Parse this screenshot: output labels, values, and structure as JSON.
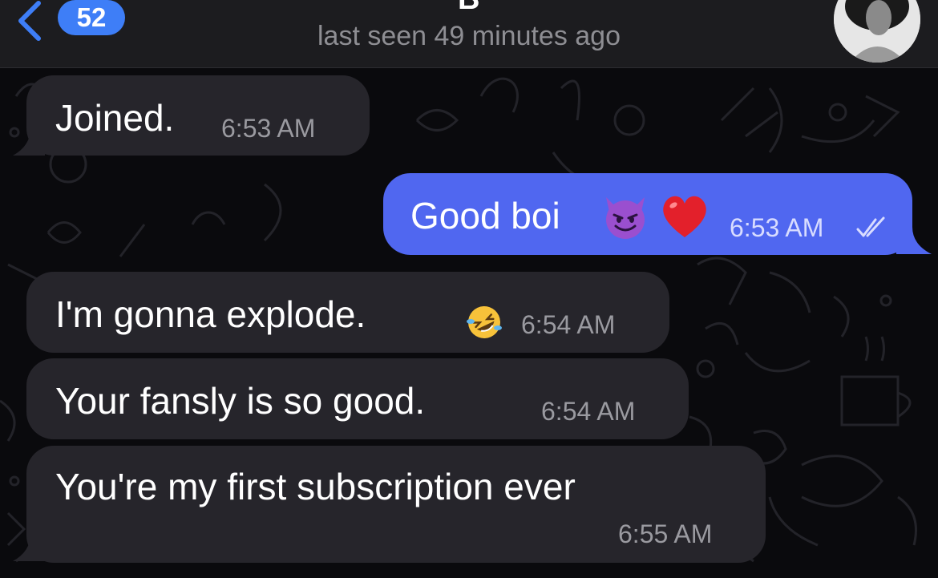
{
  "header": {
    "back_count": "52",
    "title_fragment": "B",
    "status": "last seen 49 minutes ago"
  },
  "messages": [
    {
      "direction": "incoming",
      "text": "Joined.",
      "time": "6:53 AM"
    },
    {
      "direction": "outgoing",
      "text": "Good boi",
      "emojis": [
        "smiling-devil",
        "red-heart"
      ],
      "time": "6:53 AM",
      "read": true
    },
    {
      "direction": "incoming",
      "text": "I'm gonna explode.",
      "emojis": [
        "rofl"
      ],
      "time": "6:54 AM"
    },
    {
      "direction": "incoming",
      "text": "Your fansly is so good.",
      "time": "6:54 AM"
    },
    {
      "direction": "incoming",
      "text": "You're my first subscription ever",
      "time": "6:55 AM"
    }
  ],
  "colors": {
    "incoming_bubble": "#26252b",
    "outgoing_bubble": "#5067f0",
    "badge": "#3e7ef7",
    "background": "#0a0a0d"
  },
  "icons": [
    "back-chevron-icon",
    "double-check-icon",
    "smiling-devil-emoji",
    "red-heart-emoji",
    "rofl-emoji"
  ]
}
